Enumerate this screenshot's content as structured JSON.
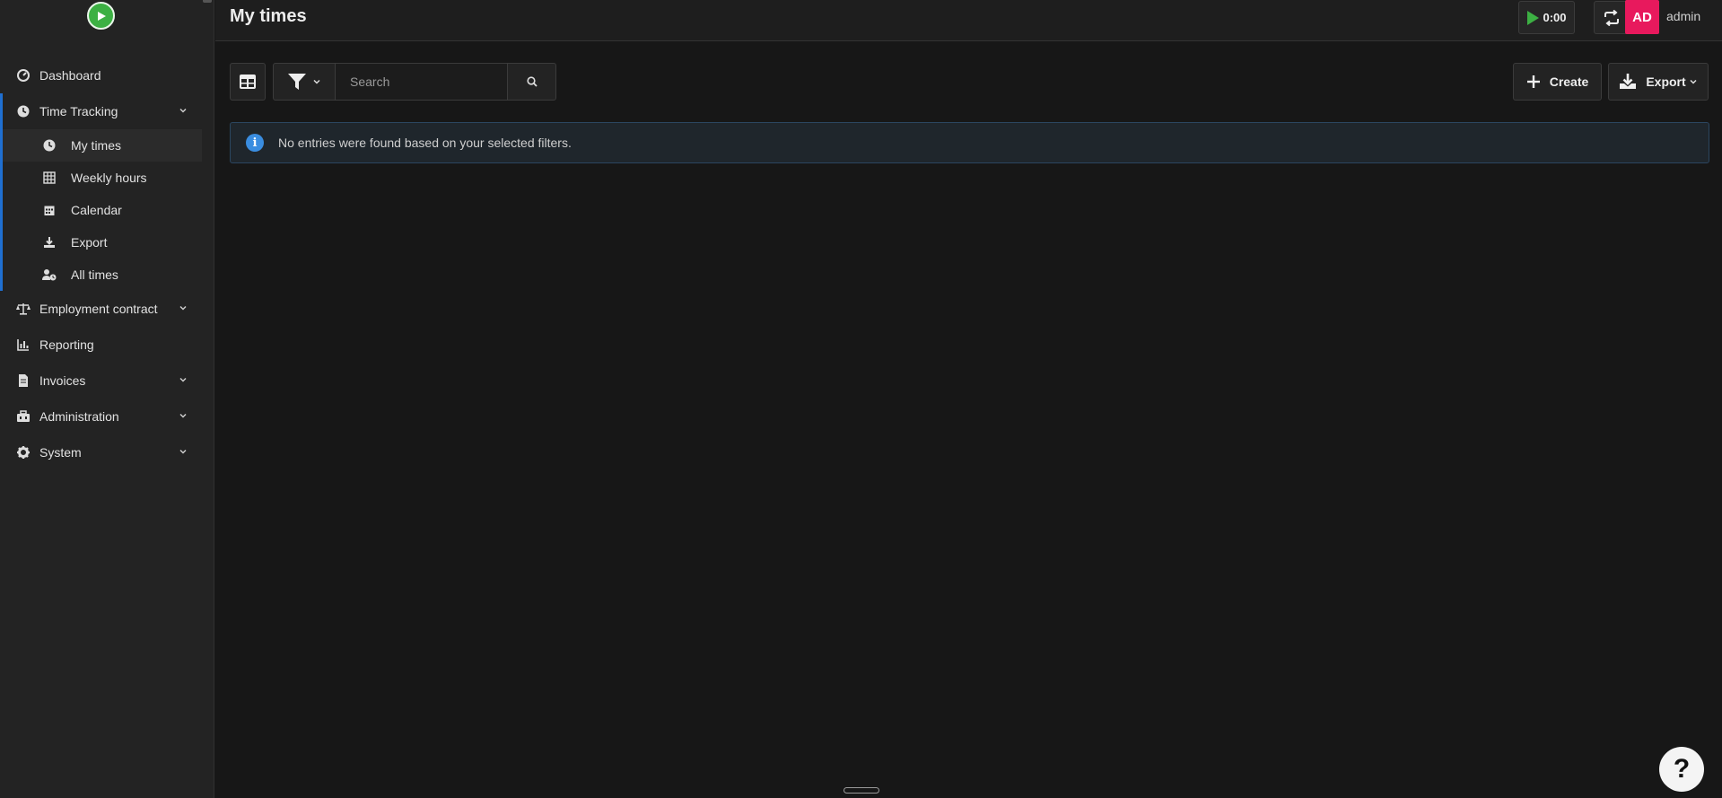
{
  "header": {
    "page_title": "My times",
    "timer_label": "0:00",
    "avatar_initials": "AD",
    "user_name": "admin",
    "avatar_color": "#e8195d"
  },
  "sidebar": {
    "logo_icon": "play-logo-icon",
    "items": [
      {
        "label": "Dashboard",
        "icon": "dashboard-icon"
      },
      {
        "label": "Time Tracking",
        "icon": "clock-icon",
        "expanded": true,
        "children": [
          {
            "label": "My times",
            "icon": "clock-icon",
            "active": true
          },
          {
            "label": "Weekly hours",
            "icon": "table-icon"
          },
          {
            "label": "Calendar",
            "icon": "calendar-icon"
          },
          {
            "label": "Export",
            "icon": "download-icon"
          },
          {
            "label": "All times",
            "icon": "user-clock-icon"
          }
        ]
      },
      {
        "label": "Employment contract",
        "icon": "scale-icon"
      },
      {
        "label": "Reporting",
        "icon": "chart-icon"
      },
      {
        "label": "Invoices",
        "icon": "invoice-icon"
      },
      {
        "label": "Administration",
        "icon": "toolbox-icon"
      },
      {
        "label": "System",
        "icon": "gear-icon"
      }
    ]
  },
  "toolbar": {
    "search_placeholder": "Search",
    "create_label": "Create",
    "export_label": "Export"
  },
  "alert": {
    "message": "No entries were found based on your selected filters.",
    "icon_text": "i"
  },
  "help": {
    "label": "?"
  },
  "colors": {
    "accent": "#1f6fd1",
    "play_green": "#3cb043",
    "info_blue": "#3a8de0"
  }
}
